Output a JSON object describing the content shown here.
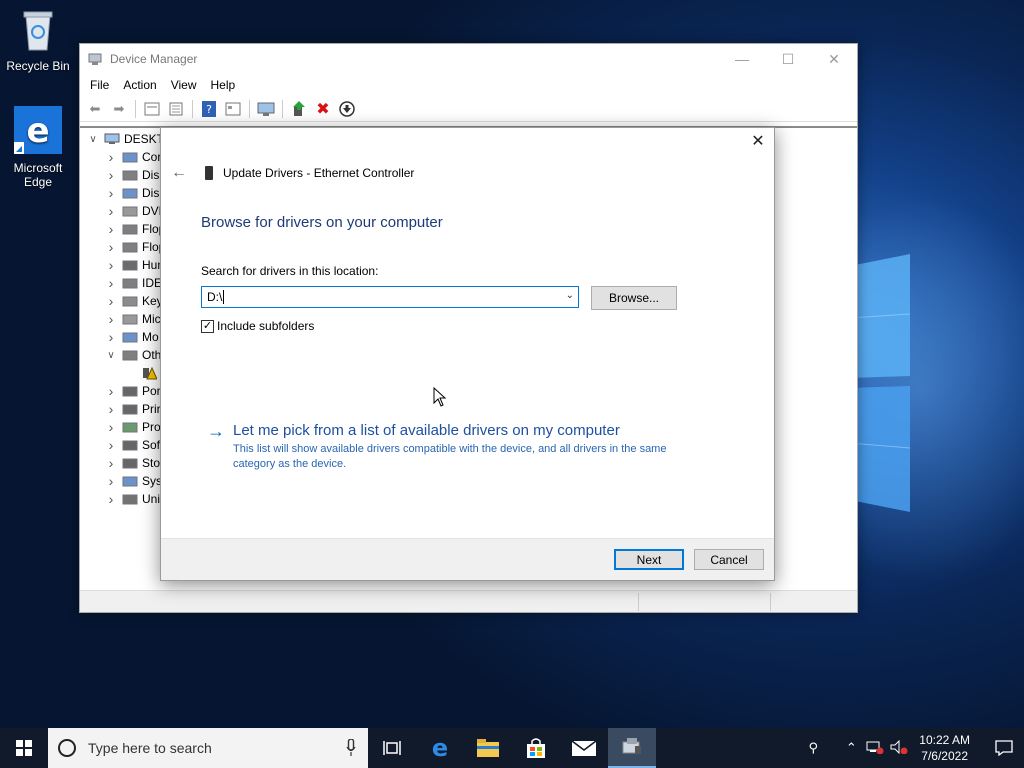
{
  "desktop": {
    "icons": [
      {
        "label": "Recycle Bin",
        "icon": "recycle-bin-icon"
      },
      {
        "label": "Microsoft Edge",
        "icon": "edge-icon"
      }
    ]
  },
  "device_manager": {
    "title": "Device Manager",
    "menu": [
      "File",
      "Action",
      "View",
      "Help"
    ],
    "toolbar_icons": [
      "back-icon",
      "forward-icon",
      "properties-icon",
      "console-tree-icon",
      "help-icon",
      "view-icon",
      "scan-hardware-icon",
      "update-driver-icon",
      "uninstall-icon",
      "download-icon"
    ],
    "tree": {
      "root": "DESKTC",
      "items": [
        {
          "label": "Cor",
          "expanded": false
        },
        {
          "label": "Disk",
          "expanded": false
        },
        {
          "label": "Disp",
          "expanded": false
        },
        {
          "label": "DVD",
          "expanded": false
        },
        {
          "label": "Flop",
          "expanded": false
        },
        {
          "label": "Flop",
          "expanded": false
        },
        {
          "label": "Hun",
          "expanded": false
        },
        {
          "label": "IDE",
          "expanded": false
        },
        {
          "label": "Key",
          "expanded": false
        },
        {
          "label": "Mic",
          "expanded": false
        },
        {
          "label": "Mo",
          "expanded": false
        },
        {
          "label": "Oth",
          "expanded": true
        },
        {
          "label": "",
          "expanded": null
        },
        {
          "label": "Por",
          "expanded": false
        },
        {
          "label": "Prir",
          "expanded": false
        },
        {
          "label": "Pro",
          "expanded": false
        },
        {
          "label": "Sof",
          "expanded": false
        },
        {
          "label": "Sto",
          "expanded": false
        },
        {
          "label": "Syst",
          "expanded": false
        },
        {
          "label": "Uni",
          "expanded": false
        }
      ]
    }
  },
  "dialog": {
    "title": "Update Drivers - Ethernet Controller",
    "heading": "Browse for drivers on your computer",
    "search_label": "Search for drivers in this location:",
    "path_value": "D:\\",
    "browse_label": "Browse...",
    "include_subfolders_label": "Include subfolders",
    "include_subfolders_checked": true,
    "pick_title": "Let me pick from a list of available drivers on my computer",
    "pick_desc": "This list will show available drivers compatible with the device, and all drivers in the same category as the device.",
    "next_label": "Next",
    "cancel_label": "Cancel"
  },
  "taskbar": {
    "search_placeholder": "Type here to search",
    "apps": [
      "task-view-icon",
      "edge-icon",
      "file-explorer-icon",
      "store-icon",
      "mail-icon",
      "device-manager-icon"
    ],
    "time": "10:22 AM",
    "date": "7/6/2022"
  }
}
